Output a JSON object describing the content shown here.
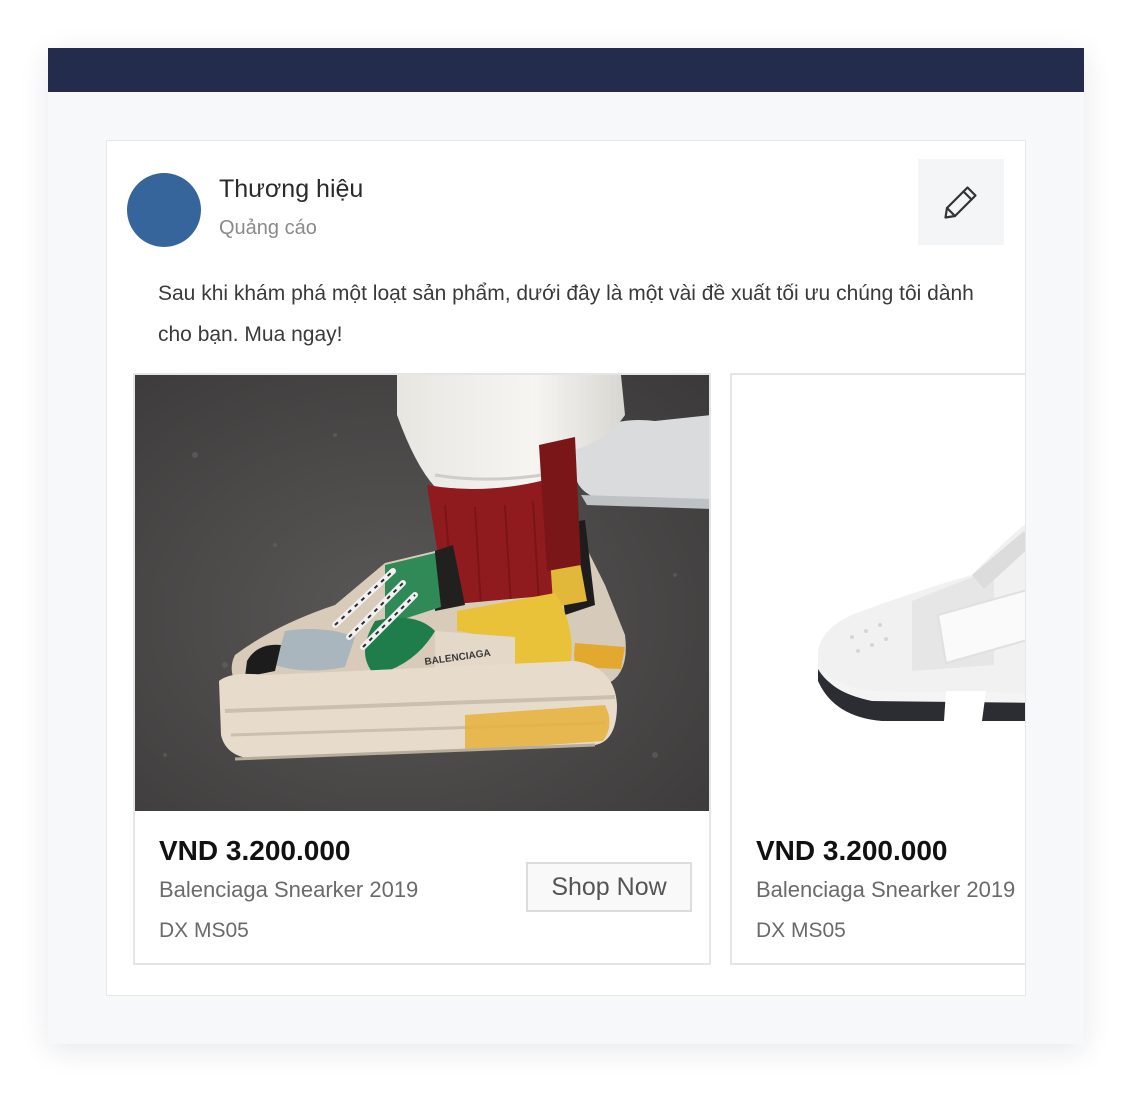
{
  "colors": {
    "topbar": "#232c4c",
    "avatar": "#36659c",
    "page_background": "#f7f8fa"
  },
  "ad": {
    "brand_name": "Thương hiệu",
    "sponsored_label": "Quảng cáo",
    "edit_icon": "pencil-icon",
    "body_text": "Sau khi khám phá một loạt sản phẩm, dưới đây là một vài đề xuất tối ưu chúng tôi dành cho bạn. Mua ngay!"
  },
  "products": [
    {
      "price": "VND 3.200.000",
      "name": "Balenciaga Snearker 2019",
      "sku": "DX MS05",
      "cta": "Shop Now",
      "image_desc": "multicolor-chunky-sneaker-photo",
      "shoe_print": "BALENCIAGA"
    },
    {
      "price": "VND 3.200.000",
      "name": "Balenciaga Snearker 2019",
      "sku": "DX MS05",
      "image_desc": "white-sneaker-photo"
    }
  ]
}
